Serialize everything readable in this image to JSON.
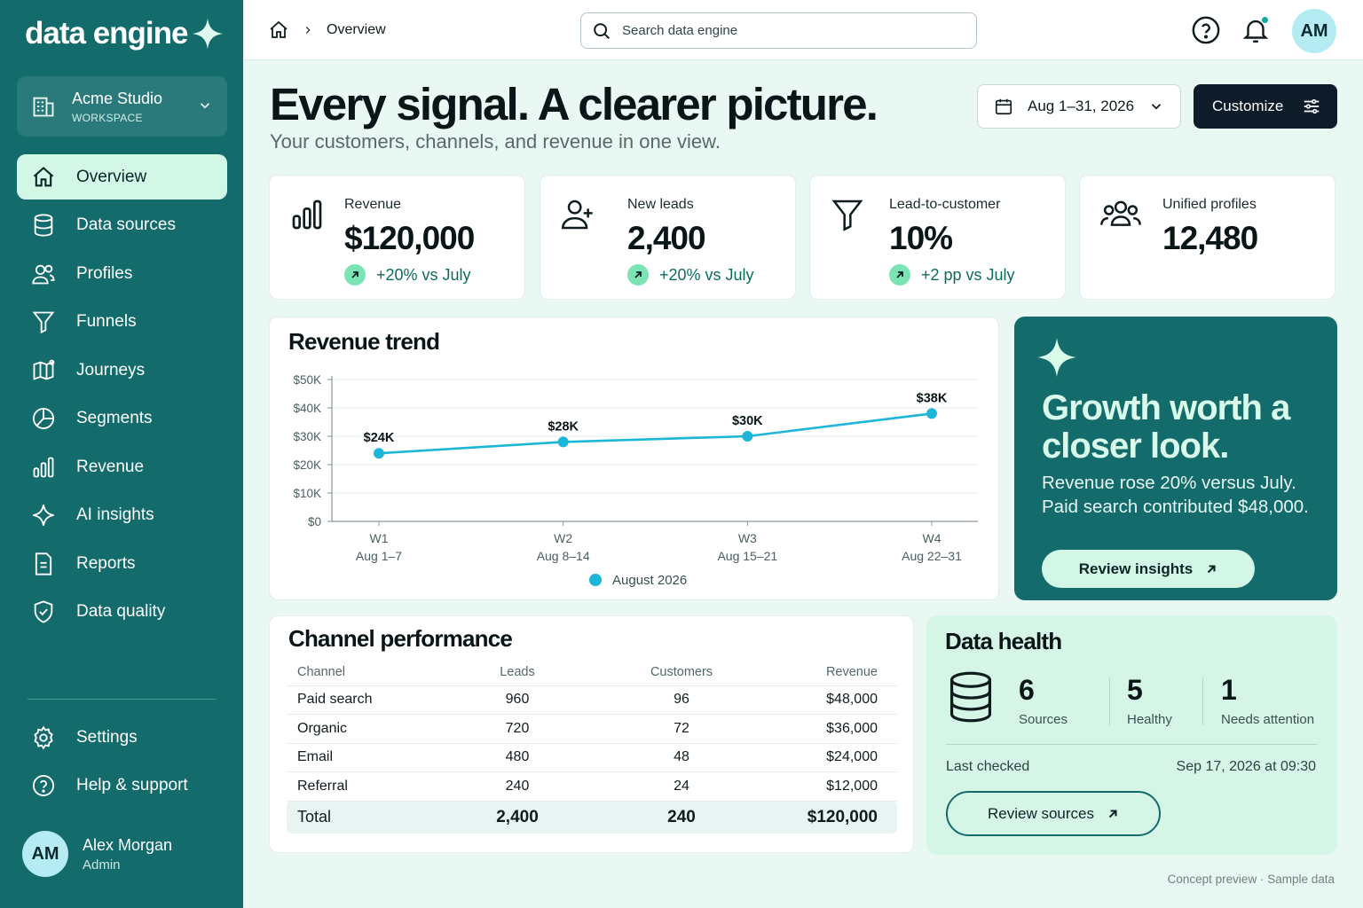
{
  "brand": {
    "name": "data engine"
  },
  "workspace": {
    "name": "Acme Studio",
    "label": "WORKSPACE"
  },
  "sidebar": {
    "items": [
      {
        "label": "Overview",
        "icon": "home-icon",
        "active": true
      },
      {
        "label": "Data sources",
        "icon": "database-icon"
      },
      {
        "label": "Profiles",
        "icon": "users-icon"
      },
      {
        "label": "Funnels",
        "icon": "funnel-icon"
      },
      {
        "label": "Journeys",
        "icon": "map-icon"
      },
      {
        "label": "Segments",
        "icon": "pie-icon"
      },
      {
        "label": "Revenue",
        "icon": "bar-chart-icon"
      },
      {
        "label": "AI insights",
        "icon": "sparkle-icon"
      },
      {
        "label": "Reports",
        "icon": "document-icon"
      },
      {
        "label": "Data quality",
        "icon": "shield-check-icon"
      }
    ],
    "footer_items": [
      {
        "label": "Settings",
        "icon": "gear-icon"
      },
      {
        "label": "Help & support",
        "icon": "help-circle-icon"
      }
    ]
  },
  "user": {
    "initials": "AM",
    "name": "Alex Morgan",
    "role": "Admin"
  },
  "topbar": {
    "breadcrumb": "Overview",
    "search_placeholder": "Search data engine",
    "avatar_initials": "AM"
  },
  "header": {
    "title": "Every signal. A clearer picture.",
    "subtitle": "Your customers, channels, and revenue in one view.",
    "date_range": "Aug 1–31, 2026",
    "customize_label": "Customize"
  },
  "kpis": [
    {
      "label": "Revenue",
      "value": "$120,000",
      "delta": "+20% vs July",
      "icon": "bar-chart-icon"
    },
    {
      "label": "New leads",
      "value": "2,400",
      "delta": "+20% vs July",
      "icon": "user-plus-icon"
    },
    {
      "label": "Lead-to-customer",
      "value": "10%",
      "delta": "+2 pp vs July",
      "icon": "funnel-icon"
    },
    {
      "label": "Unified profiles",
      "value": "12,480",
      "delta": "",
      "icon": "users-group-icon"
    }
  ],
  "chart_data": {
    "type": "line",
    "title": "Revenue trend",
    "categories": [
      "W1",
      "W2",
      "W3",
      "W4"
    ],
    "category_sublabels": [
      "Aug 1–7",
      "Aug 8–14",
      "Aug 15–21",
      "Aug 22–31"
    ],
    "series": [
      {
        "name": "August 2026",
        "values": [
          24000,
          28000,
          30000,
          38000
        ],
        "labels": [
          "$24K",
          "$28K",
          "$30K",
          "$38K"
        ],
        "color": "#1cb6d8"
      }
    ],
    "y_ticks": [
      "$0",
      "$10K",
      "$20K",
      "$30K",
      "$40K",
      "$50K"
    ],
    "ylim": [
      0,
      50000
    ],
    "grid": "horizontal",
    "legend": "bottom-center"
  },
  "promo": {
    "title": "Growth worth a closer look.",
    "text": "Revenue rose 20% versus July. Paid search contributed $48,000.",
    "button": "Review insights"
  },
  "channel": {
    "title": "Channel performance",
    "columns": [
      "Channel",
      "Leads",
      "Customers",
      "Revenue"
    ],
    "rows": [
      [
        "Paid search",
        "960",
        "96",
        "$48,000"
      ],
      [
        "Organic",
        "720",
        "72",
        "$36,000"
      ],
      [
        "Email",
        "480",
        "48",
        "$24,000"
      ],
      [
        "Referral",
        "240",
        "24",
        "$12,000"
      ]
    ],
    "total": [
      "Total",
      "2,400",
      "240",
      "$120,000"
    ]
  },
  "health": {
    "title": "Data health",
    "stats": [
      {
        "value": "6",
        "label": "Sources"
      },
      {
        "value": "5",
        "label": "Healthy"
      },
      {
        "value": "1",
        "label": "Needs attention"
      }
    ],
    "last_checked_label": "Last checked",
    "last_checked_value": "Sep 17, 2026 at 09:30",
    "button": "Review sources"
  },
  "footer_note": "Concept preview · Sample data",
  "colors": {
    "sidebar": "#136b6c",
    "accent_mint": "#d2f7e6",
    "line": "#1cb6d8",
    "dark_button": "#0e1c2a"
  }
}
